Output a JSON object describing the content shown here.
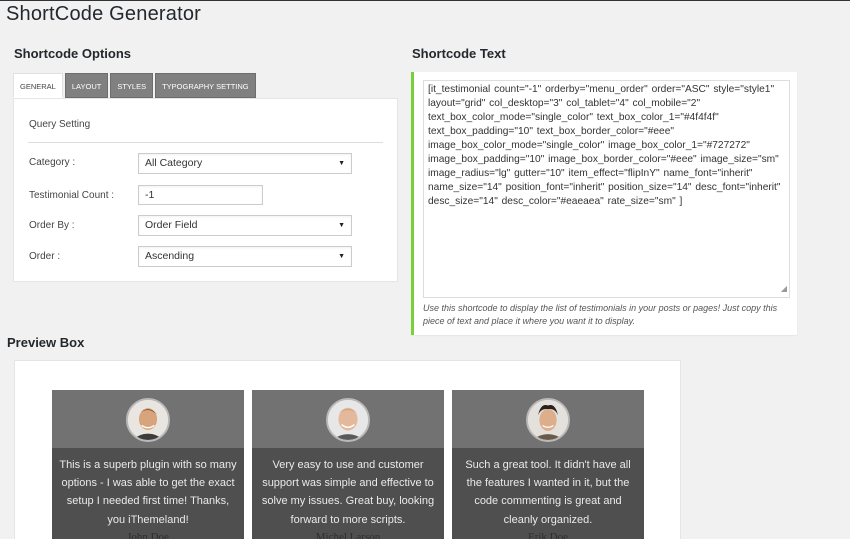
{
  "page_title": "ShortCode Generator",
  "options": {
    "title": "Shortcode Options",
    "tabs": [
      {
        "label": "GENERAL",
        "active": true
      },
      {
        "label": "LAYOUT",
        "active": false
      },
      {
        "label": "STYLES",
        "active": false
      },
      {
        "label": "TYPOGRAPHY SETTING",
        "active": false
      }
    ],
    "panel_heading": "Query Setting",
    "category_label": "Category :",
    "category_value": "All Category",
    "count_label": "Testimonial Count :",
    "count_value": "-1",
    "orderby_label": "Order By :",
    "orderby_value": "Order Field",
    "order_label": "Order :",
    "order_value": "Ascending"
  },
  "shortcode": {
    "title": "Shortcode Text",
    "text": "[it_testimonial count=\"-1\"  orderby=\"menu_order\"  order=\"ASC\"  style=\"style1\"  layout=\"grid\"  col_desktop=\"3\"  col_tablet=\"4\"  col_mobile=\"2\"  text_box_color_mode=\"single_color\"  text_box_color_1=\"#4f4f4f\"  text_box_padding=\"10\"  text_box_border_color=\"#eee\"  image_box_color_mode=\"single_color\"  image_box_color_1=\"#727272\"  image_box_padding=\"10\"  image_box_border_color=\"#eee\"  image_size=\"sm\"  image_radius=\"lg\"  gutter=\"10\"  item_effect=\"flipInY\"  name_font=\"inherit\"  name_size=\"14\"  position_font=\"inherit\"  position_size=\"14\"  desc_font=\"inherit\"  desc_size=\"14\"  desc_color=\"#eaeaea\"  rate_size=\"sm\" ]",
    "help": "Use this shortcode to display the list of testimonials in your posts or pages! Just copy this piece of text and place it where you want it to display."
  },
  "preview": {
    "title": "Preview Box",
    "cards": [
      {
        "desc": "This is a superb plugin with so many options - I was able to get the exact setup I needed first time! Thanks, you iThemeland!",
        "name": "John Doe"
      },
      {
        "desc": "Very easy to use and customer support was simple and effective to solve my issues. Great buy, looking forward to more scripts.",
        "name": "Michel Larson"
      },
      {
        "desc": "Such a great tool. It didn't have all the features I wanted in it, but the code commenting is great and cleanly organized.",
        "name": "Erik Doe"
      }
    ]
  },
  "colors": {
    "accent_border": "#7ad03a",
    "card_text_bg": "#4f4f4f",
    "card_image_bg": "#727272",
    "card_desc_color": "#eaeaea",
    "tab_inactive_bg": "#808080"
  }
}
